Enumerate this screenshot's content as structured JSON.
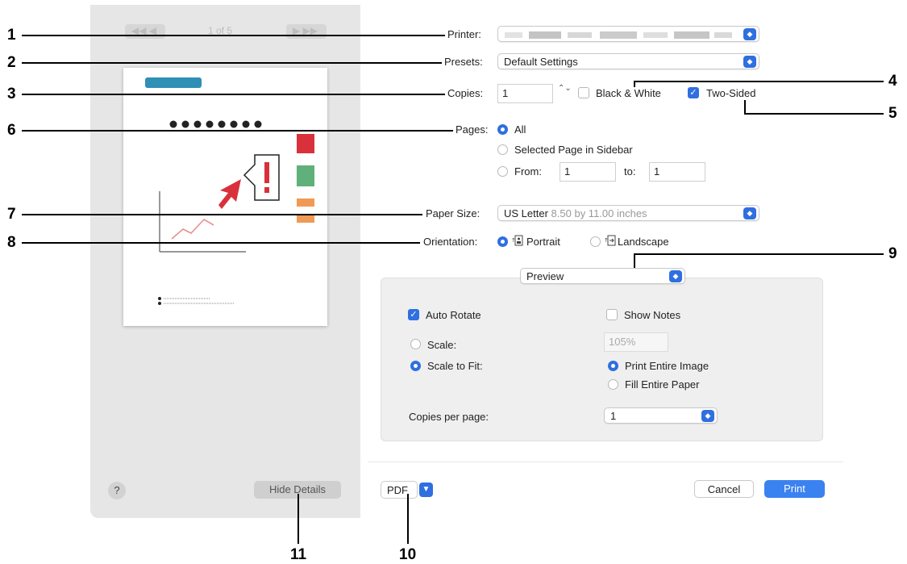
{
  "sidebar": {
    "nav_prev": "◀◀ ◀",
    "page_indicator": "1 of 5",
    "nav_next": "▶ ▶▶",
    "help_label": "?",
    "hide_details_label": "Hide Details"
  },
  "printer": {
    "label": "Printer:"
  },
  "presets": {
    "label": "Presets:",
    "value": "Default Settings"
  },
  "copies": {
    "label": "Copies:",
    "value": "1",
    "stepper_glyph": "⌃⌄",
    "black_white_label": "Black & White",
    "two_sided_label": "Two-Sided",
    "black_white_checked": false,
    "two_sided_checked": true
  },
  "pages": {
    "label": "Pages:",
    "all_label": "All",
    "selected_label": "Selected Page in Sidebar",
    "from_label": "From:",
    "from_value": "1",
    "to_label": "to:",
    "to_value": "1"
  },
  "paper_size": {
    "label": "Paper Size:",
    "value": "US Letter",
    "detail": "8.50 by 11.00 inches"
  },
  "orientation": {
    "label": "Orientation:",
    "portrait_label": "Portrait",
    "landscape_label": "Landscape"
  },
  "section_popup": {
    "value": "Preview"
  },
  "preview_panel": {
    "auto_rotate_label": "Auto Rotate",
    "show_notes_label": "Show Notes",
    "scale_label": "Scale:",
    "scale_value": "105%",
    "scale_to_fit_label": "Scale to Fit:",
    "print_entire_image_label": "Print Entire Image",
    "fill_entire_paper_label": "Fill Entire Paper",
    "copies_per_page_label": "Copies per page:",
    "copies_per_page_value": "1"
  },
  "bottom": {
    "pdf_label": "PDF",
    "cancel_label": "Cancel",
    "print_label": "Print"
  },
  "callouts": [
    "1",
    "2",
    "3",
    "4",
    "5",
    "6",
    "7",
    "8",
    "9",
    "10",
    "11"
  ],
  "preview_image": {
    "alert_mark": "!"
  },
  "colors": {
    "accent": "#2f6fe0",
    "alert_red": "#d8313b",
    "bar_green": "#5fb07a",
    "bar_orange": "#f09a55",
    "bar_blue": "#2f8fb5"
  }
}
